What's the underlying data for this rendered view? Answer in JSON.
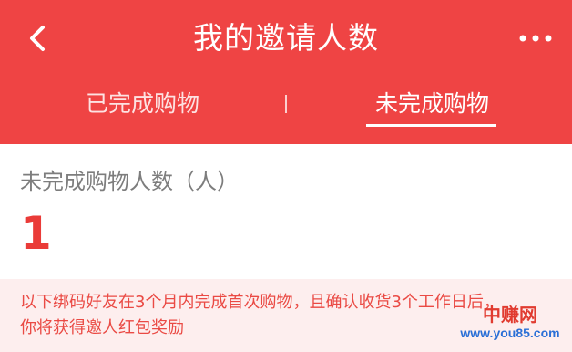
{
  "header": {
    "title": "我的邀请人数",
    "back_icon": "back-chevron-icon",
    "more_icon": "more-dots-icon",
    "background_color": "#ef4444"
  },
  "tabs": [
    {
      "label": "已完成购物",
      "selected": false
    },
    {
      "label": "未完成购物",
      "selected": true
    }
  ],
  "stats": {
    "label": "未完成购物人数（人）",
    "value": "1",
    "value_color": "#ea3b38"
  },
  "notice": {
    "line1": "以下绑码好友在3个月内完成首次购物，且确认收货3个工作日后，",
    "line2": "你将获得邀人红包奖励",
    "text_color": "#ea4a44",
    "background_color": "#fdeeee"
  },
  "watermark": {
    "name": "中赚网",
    "url": "www.you85.com"
  }
}
